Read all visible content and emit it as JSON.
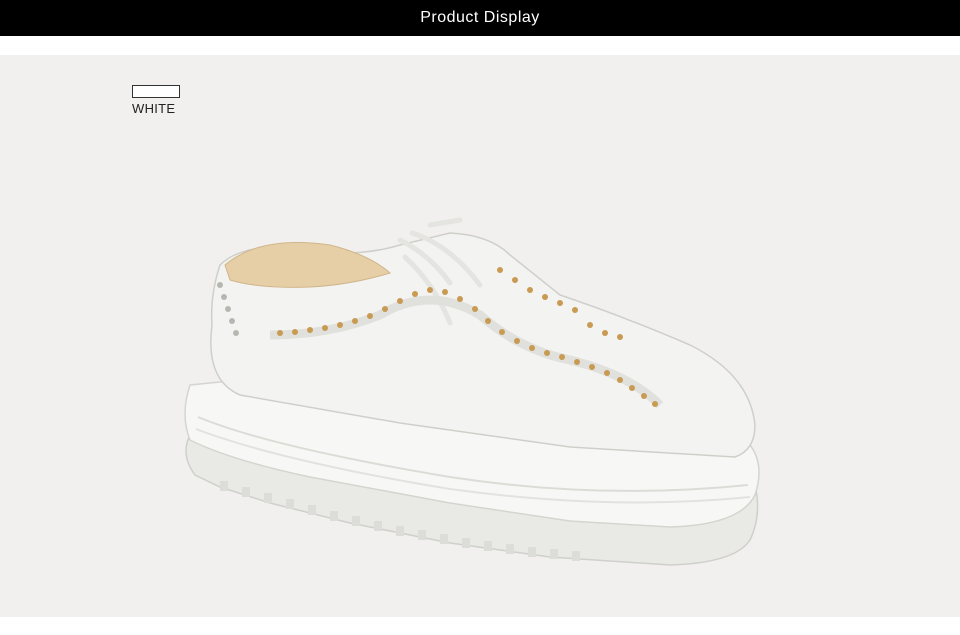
{
  "header": {
    "title": "Product Display"
  },
  "swatch": {
    "label": "WHITE",
    "color": "#ffffff"
  },
  "colors": {
    "header_bg": "#000000",
    "stage_bg": "#f1f0ee",
    "stud": "#c99a52"
  }
}
